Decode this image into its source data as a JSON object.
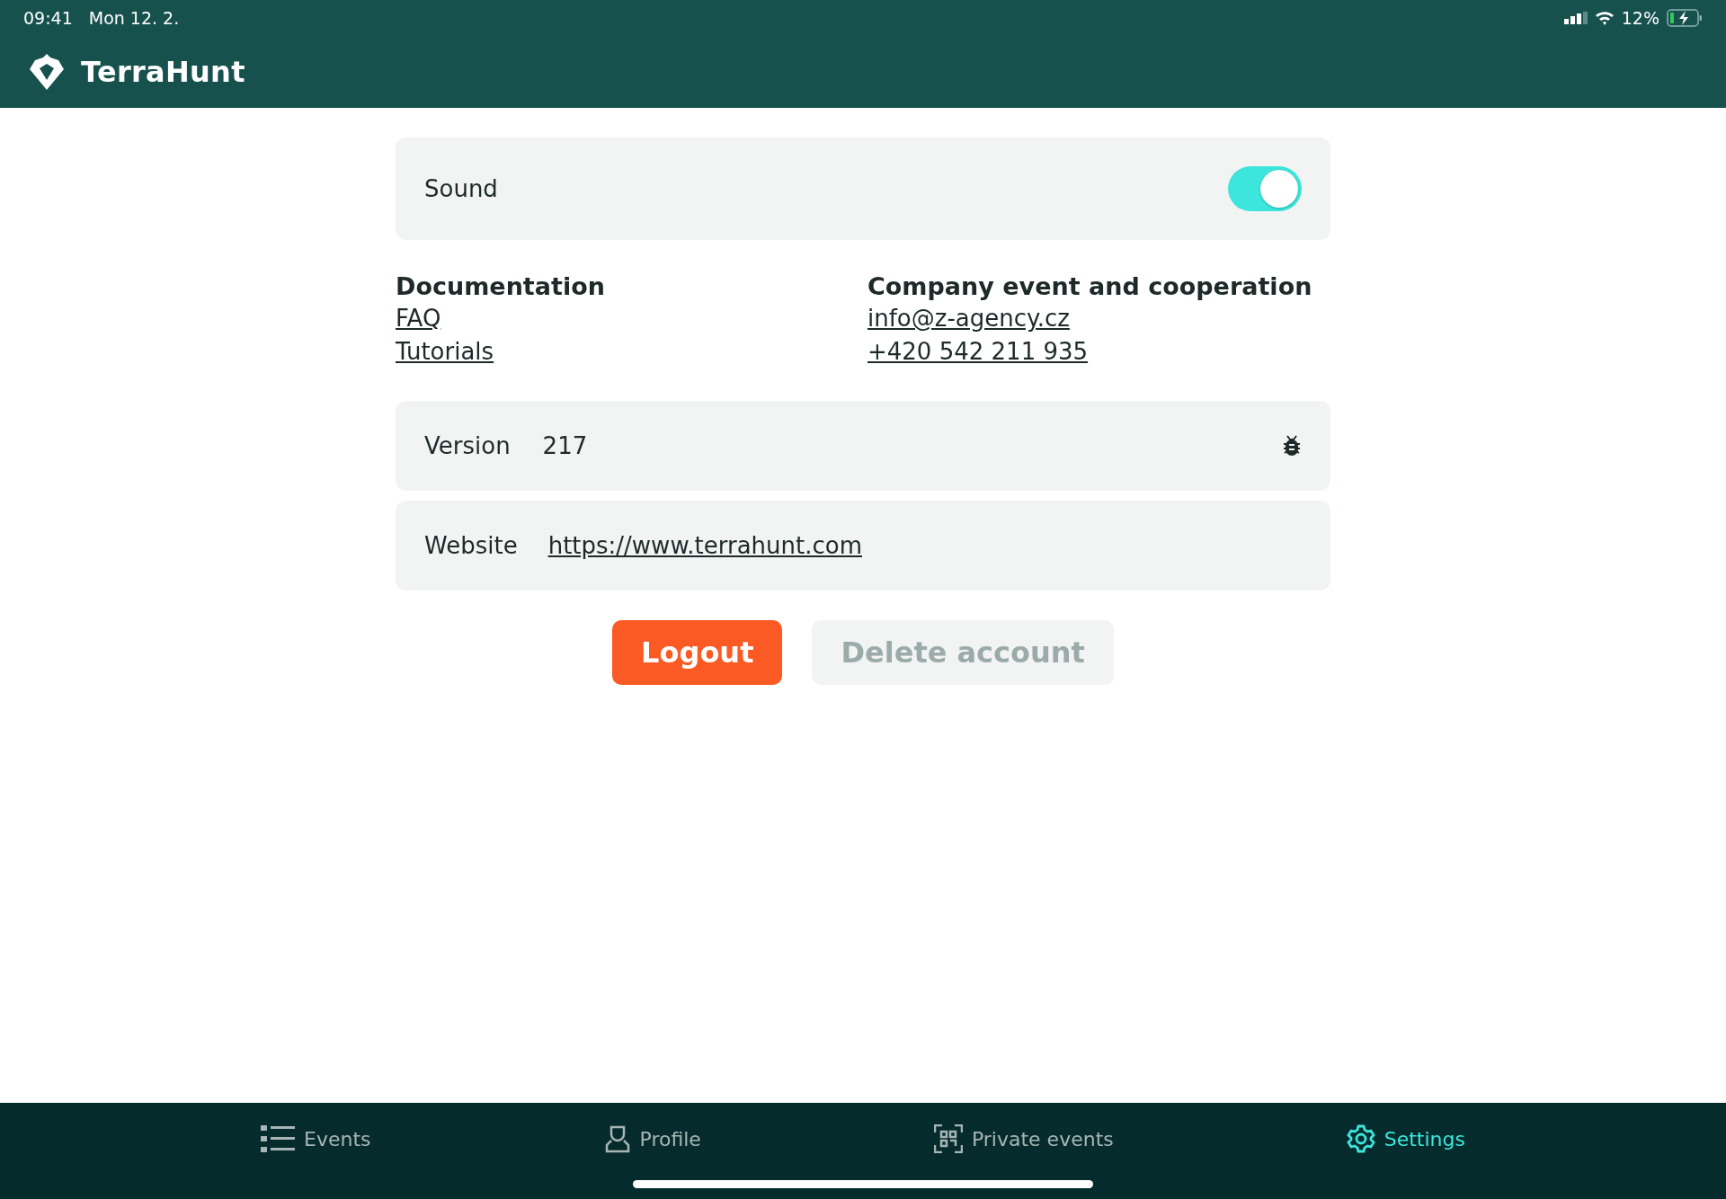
{
  "status_bar": {
    "time": "09:41",
    "date": "Mon 12. 2.",
    "battery": "12%"
  },
  "app_bar": {
    "title": "TerraHunt"
  },
  "sound": {
    "label": "Sound",
    "on": true
  },
  "documentation": {
    "heading": "Documentation",
    "links": [
      "FAQ",
      "Tutorials"
    ]
  },
  "contact": {
    "heading": "Company event and cooperation",
    "links": [
      "info@z-agency.cz",
      "+420 542 211 935"
    ]
  },
  "version": {
    "label": "Version",
    "value": "217"
  },
  "website": {
    "label": "Website",
    "url": "https://www.terrahunt.com"
  },
  "buttons": [
    {
      "label": "Logout",
      "disabled": false
    },
    {
      "label": "Delete account",
      "disabled": true
    }
  ],
  "tabs": [
    {
      "label": "Events",
      "selected": false
    },
    {
      "label": "Profile",
      "selected": false
    },
    {
      "label": "Private events",
      "selected": false
    },
    {
      "label": "Settings",
      "selected": true
    }
  ]
}
